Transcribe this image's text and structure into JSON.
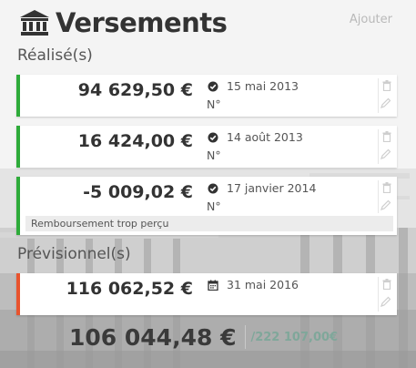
{
  "header": {
    "title": "Versements",
    "add_label": "Ajouter"
  },
  "sections": {
    "realised": {
      "label": "Réalisé(s)"
    },
    "forecast": {
      "label": "Prévisionnel(s)"
    }
  },
  "payments": [
    {
      "amount": "94 629,50 €",
      "date": "15 mai 2013",
      "numero": "N°",
      "status_icon": "check-circle-icon"
    },
    {
      "amount": "16 424,00 €",
      "date": "14 août 2013",
      "numero": "N°",
      "status_icon": "check-circle-icon"
    },
    {
      "amount": "-5 009,02 €",
      "date": "17 janvier 2014",
      "numero": "N°",
      "status_icon": "check-circle-icon",
      "comment": "Remboursement trop perçu"
    }
  ],
  "forecast_payments": [
    {
      "amount": "116 062,52 €",
      "date": "31 mai 2016",
      "status_icon": "calendar-icon"
    }
  ],
  "totals": {
    "total": "106 044,48 €",
    "target": "/222 107,00€"
  },
  "colors": {
    "realised_accent": "#2eab3a",
    "forecast_accent": "#e8542e",
    "target_text": "#7fa79a"
  }
}
